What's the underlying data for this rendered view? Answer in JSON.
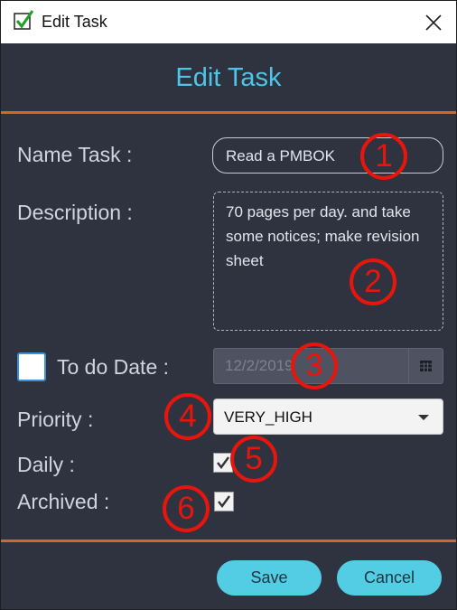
{
  "window": {
    "title": "Edit Task"
  },
  "header": {
    "title": "Edit Task"
  },
  "form": {
    "name_label": "Name Task :",
    "name_value": "Read a PMBOK",
    "description_label": "Description :",
    "description_value": "70 pages per day. and take some notices; make revision sheet",
    "todo_label": "To do Date :",
    "todo_checked": false,
    "date_value": "12/2/2019",
    "priority_label": "Priority :",
    "priority_value": "VERY_HIGH",
    "daily_label": "Daily :",
    "daily_checked": true,
    "archived_label": "Archived :",
    "archived_checked": true
  },
  "buttons": {
    "save": "Save",
    "cancel": "Cancel"
  },
  "annotations": [
    "1",
    "2",
    "3",
    "4",
    "5",
    "6"
  ],
  "colors": {
    "background": "#2f3340",
    "accent": "#4fc4e6",
    "rule": "#d9661f",
    "button": "#53cde3",
    "annotation": "#e8150d"
  },
  "icons": {
    "app": "checkmark-icon",
    "close": "close-icon",
    "date": "calendar-icon",
    "combo": "chevron-down-icon"
  }
}
